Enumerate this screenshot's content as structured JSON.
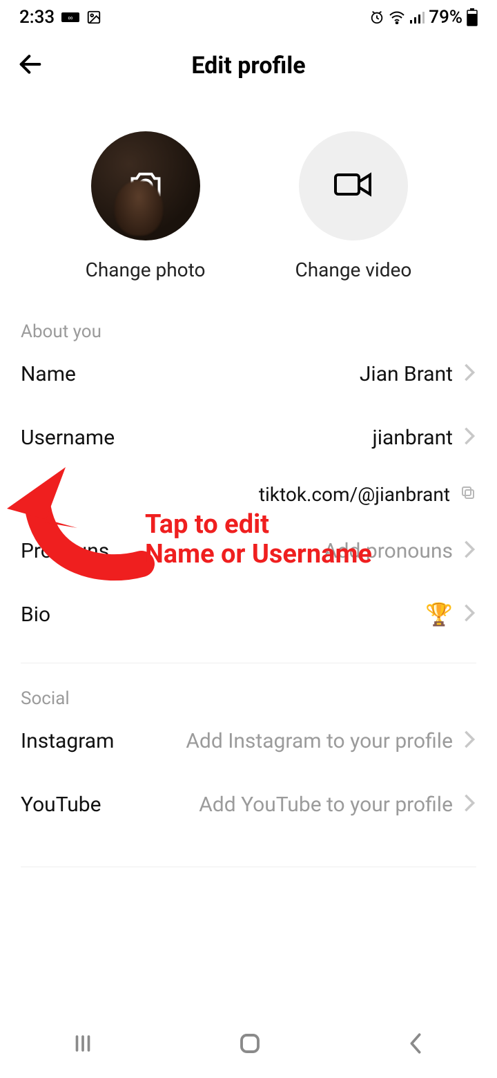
{
  "status": {
    "time": "2:33",
    "battery": "79%"
  },
  "header": {
    "title": "Edit profile"
  },
  "media": {
    "photo_label": "Change photo",
    "video_label": "Change video"
  },
  "sections": {
    "about_label": "About you",
    "social_label": "Social"
  },
  "rows": {
    "name": {
      "label": "Name",
      "value": "Jian Brant"
    },
    "username": {
      "label": "Username",
      "value": "jianbrant"
    },
    "url": {
      "value": "tiktok.com/@jianbrant"
    },
    "pronouns": {
      "label": "Pronouns",
      "value": "Add pronouns"
    },
    "bio": {
      "label": "Bio",
      "value": "🏆"
    },
    "instagram": {
      "label": "Instagram",
      "value": "Add Instagram to your profile"
    },
    "youtube": {
      "label": "YouTube",
      "value": "Add YouTube to your profile"
    }
  },
  "annotation": {
    "line1": "Tap to edit",
    "line2": "Name or Username"
  }
}
